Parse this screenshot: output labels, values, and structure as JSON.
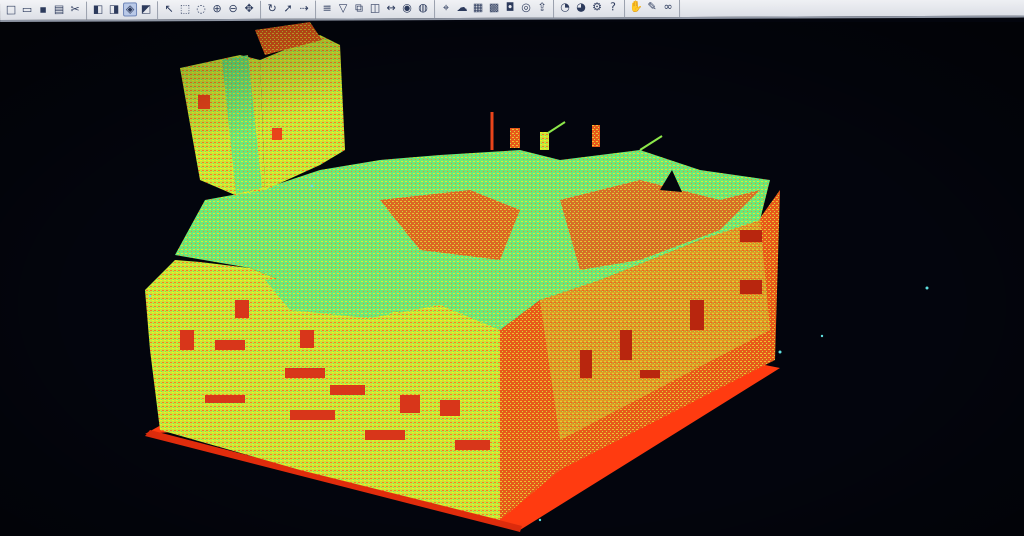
{
  "toolbar": {
    "groups": [
      {
        "name": "file",
        "icons": [
          "new-icon",
          "open-icon",
          "save-icon",
          "print-icon",
          "cut-icon"
        ]
      },
      {
        "name": "view-cube",
        "icons": [
          "front-view-icon",
          "top-view-icon",
          "iso-view-icon",
          "side-view-icon"
        ]
      },
      {
        "name": "selection",
        "icons": [
          "pointer-icon",
          "select-box-icon",
          "lasso-icon",
          "zoom-in-icon",
          "zoom-out-icon",
          "pan-icon"
        ]
      },
      {
        "name": "orbit",
        "icons": [
          "orbit-icon",
          "fly-icon",
          "walk-icon"
        ]
      },
      {
        "name": "layers",
        "icons": [
          "layers-icon",
          "filter-icon",
          "clip-icon",
          "section-icon",
          "measure-icon",
          "render-icon",
          "globe-icon"
        ]
      },
      {
        "name": "scan",
        "icons": [
          "scan-icon",
          "cloud-icon",
          "mesh-icon",
          "grid-icon",
          "camera-icon",
          "target-icon",
          "export-icon"
        ]
      },
      {
        "name": "tools",
        "icons": [
          "eye-icon",
          "color-icon",
          "settings-icon",
          "help-icon"
        ]
      },
      {
        "name": "more",
        "icons": [
          "hand-icon",
          "note-icon",
          "link-icon"
        ]
      }
    ]
  },
  "viewport": {
    "background": "#03050d",
    "palette": {
      "high": "#eef21e",
      "mid": "#8de84a",
      "green": "#5ee87a",
      "low": "#f05a14",
      "ground": "#ff3b10"
    }
  }
}
